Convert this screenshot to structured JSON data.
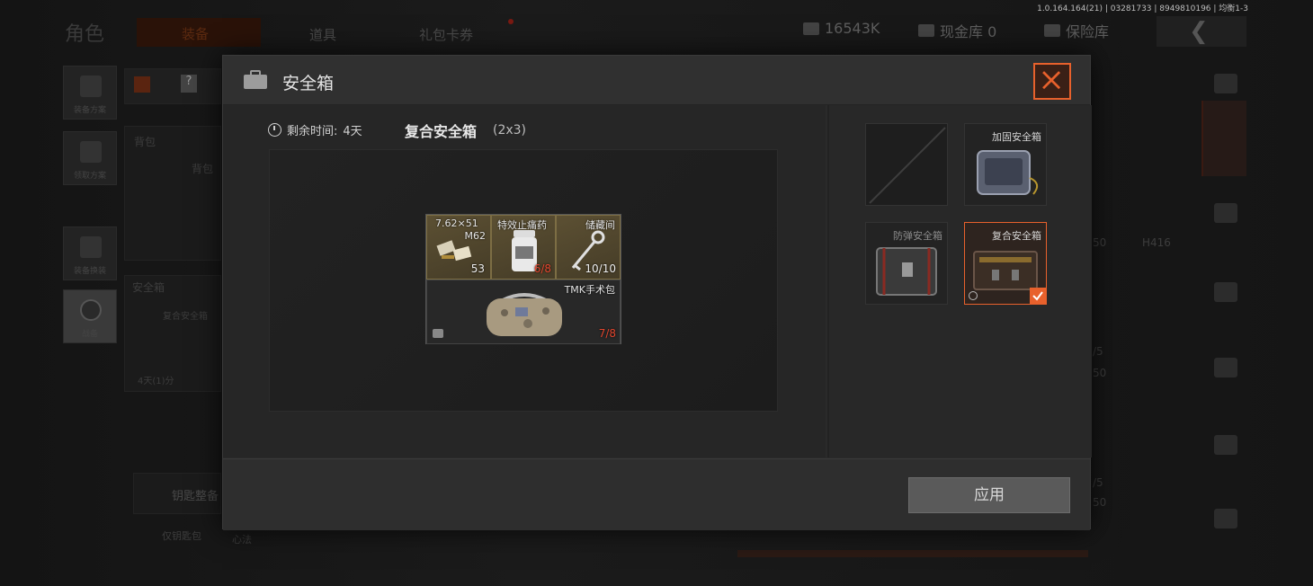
{
  "version_text": "1.0.164.164(21) | 03281733 | 8949810196 | 均衡1-3",
  "background": {
    "title": "角色",
    "tabs": [
      "装备",
      "道具",
      "礼包卡券"
    ],
    "currency_amount": "16543K",
    "cash_vault": "现金库 0",
    "insurance_vault": "保险库",
    "back_icon": "chevron-left-icon",
    "side_buttons": [
      "装备方案",
      "领取方案",
      "装备换装",
      "战备"
    ],
    "backpack_label": "背包",
    "backpack_sub": "背包",
    "safebox_label": "安全箱",
    "safebox_item": "复合安全箱",
    "safebox_timer": "4天(1)分",
    "key_label": "钥匙整备",
    "misc_labels": [
      "仅钥匙包",
      "心法"
    ],
    "right_labels": [
      "50",
      "H416",
      "/5",
      "50",
      "/5",
      "50"
    ]
  },
  "modal": {
    "title": "安全箱",
    "remaining_label": "剩余时间:",
    "remaining_value": "4天",
    "case_name": "复合安全箱",
    "case_size": "(2x3)",
    "close_icon": "close-icon",
    "items": [
      {
        "name": "7.62×51",
        "subname": "M62",
        "count": "53",
        "count_color": "#eeeeee",
        "rarity": "gold"
      },
      {
        "name": "特效止痛药",
        "count": "6/8",
        "count_color": "#e2462e",
        "rarity": "gold"
      },
      {
        "name": "储藏间",
        "count": "10/10",
        "count_color": "#eeeeee",
        "rarity": "gold"
      },
      {
        "name": "TMK手术包",
        "count": "7/8",
        "count_color": "#e2462e",
        "rarity": "dark"
      }
    ],
    "cases": [
      {
        "name": "",
        "state": "empty"
      },
      {
        "name": "加固安全箱",
        "state": "available"
      },
      {
        "name": "防弹安全箱",
        "state": "dim"
      },
      {
        "name": "复合安全箱",
        "state": "selected"
      }
    ],
    "apply_label": "应用",
    "accent_color": "#e8612c"
  }
}
